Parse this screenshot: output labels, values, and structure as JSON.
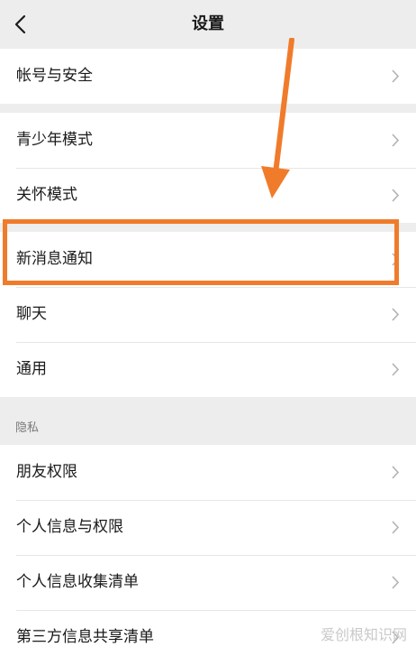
{
  "header": {
    "title": "设置"
  },
  "groups": [
    {
      "items": [
        {
          "label": "帐号与安全"
        }
      ]
    },
    {
      "items": [
        {
          "label": "青少年模式"
        },
        {
          "label": "关怀模式"
        }
      ]
    },
    {
      "items": [
        {
          "label": "新消息通知"
        },
        {
          "label": "聊天"
        },
        {
          "label": "通用"
        }
      ]
    },
    {
      "items": [
        {
          "label": "朋友权限"
        },
        {
          "label": "个人信息与权限"
        },
        {
          "label": "个人信息收集清单"
        },
        {
          "label": "第三方信息共享清单"
        }
      ]
    }
  ],
  "section": {
    "privacy_label": "隐私"
  },
  "annotation": {
    "highlight_color": "#f07b2a",
    "arrow_color": "#f07b2a"
  },
  "watermark": {
    "text": "爱创根知识网"
  },
  "icons": {
    "back": "chevron-left-icon",
    "row": "chevron-right-icon"
  }
}
